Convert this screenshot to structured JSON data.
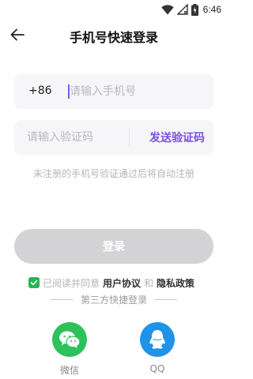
{
  "status_bar": {
    "time": "6:46"
  },
  "header": {
    "title": "手机号快速登录"
  },
  "phone": {
    "prefix": "+86",
    "placeholder": "请输入手机号"
  },
  "code": {
    "placeholder": "请输入验证码",
    "send_label": "发送验证码"
  },
  "hint": "未注册的手机号验证通过后将自动注册",
  "login_label": "登录",
  "agreement": {
    "checked": true,
    "prefix": "已阅读并同意",
    "user_agreement": "用户协议",
    "and": "和",
    "privacy_policy": "隐私政策"
  },
  "third_party": {
    "title": "第三方快捷登录",
    "options": [
      {
        "label": "微信",
        "icon": "wechat-icon"
      },
      {
        "label": "QQ",
        "icon": "qq-icon"
      }
    ]
  },
  "colors": {
    "accent": "#7a4fe0",
    "check_green": "#26b552",
    "wechat_green": "#2dc15a",
    "qq_blue": "#1e93e8",
    "login_disabled": "#d3d3d6"
  }
}
